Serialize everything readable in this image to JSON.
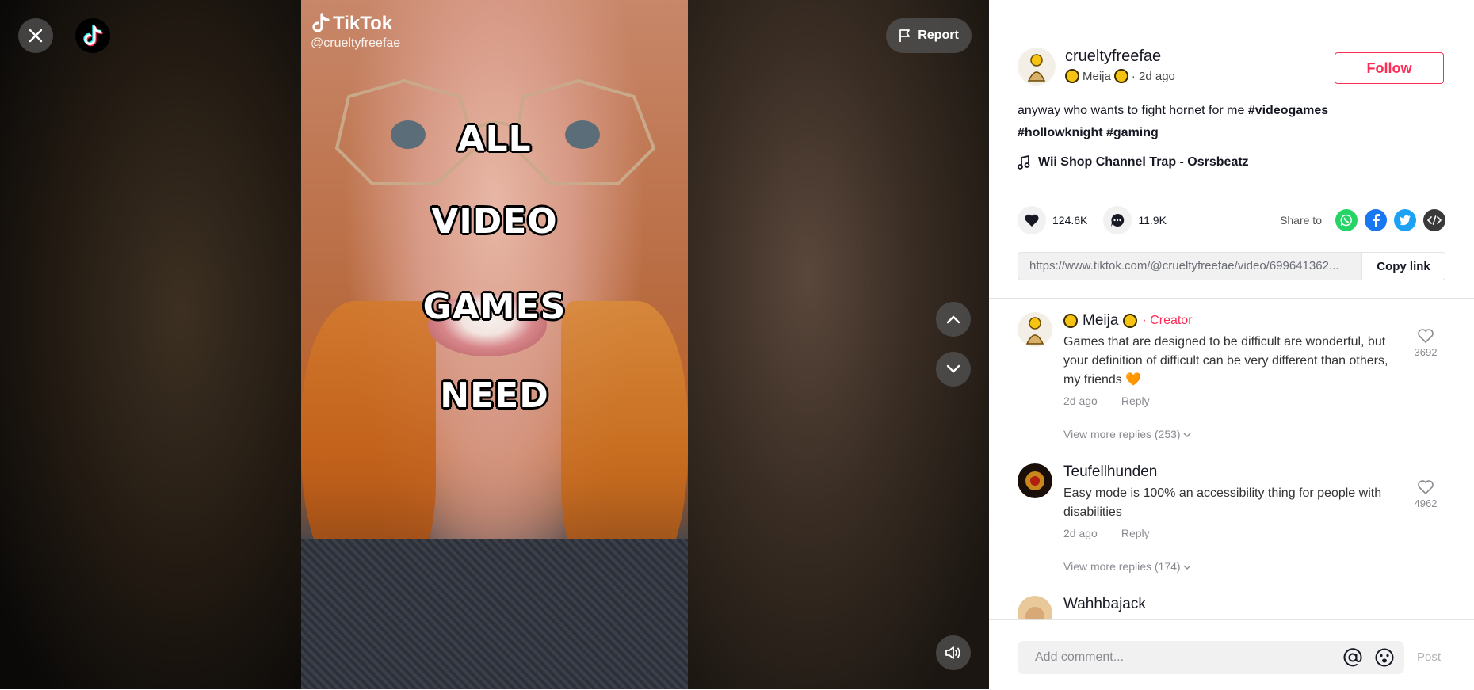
{
  "video": {
    "watermark_brand": "TikTok",
    "watermark_handle": "@crueltyfreefae",
    "overlay_words": [
      "ALL",
      "VIDEO",
      "GAMES",
      "NEED"
    ],
    "report_label": "Report"
  },
  "author": {
    "username": "crueltyfreefae",
    "display_name": "Meija",
    "posted": "· 2d ago",
    "follow_label": "Follow"
  },
  "description": {
    "text": "anyway who wants to fight hornet for me ",
    "tags": [
      "#videogames",
      "#hollowknight",
      "#gaming"
    ]
  },
  "music": {
    "title": "Wii Shop Channel Trap - Osrsbeatz"
  },
  "actions": {
    "likes": "124.6K",
    "comments": "11.9K",
    "share_label": "Share to"
  },
  "link": {
    "url": "https://www.tiktok.com/@crueltyfreefae/video/699641362...",
    "copy_label": "Copy link"
  },
  "comments": [
    {
      "name": "Meija",
      "badge": "· Creator",
      "text": "Games that are designed to be difficult are wonderful, but your definition of difficult can be very different than others, my friends",
      "emoji": "🧡",
      "time": "2d ago",
      "reply_label": "Reply",
      "likes": "3692",
      "view_more": "View more replies (253)"
    },
    {
      "name": "Teufellhunden",
      "text": "Easy mode is 100% an accessibility thing for people with disabilities",
      "time": "2d ago",
      "reply_label": "Reply",
      "likes": "4962",
      "view_more": "View more replies (174)"
    },
    {
      "name": "Wahhbajack"
    }
  ],
  "add_comment": {
    "placeholder": "Add comment...",
    "post_label": "Post"
  },
  "colors": {
    "accent": "#fe2c55",
    "whatsapp": "#25d366",
    "facebook": "#1877f2",
    "twitter": "#1da1f2",
    "embed": "#3a3a3a"
  }
}
